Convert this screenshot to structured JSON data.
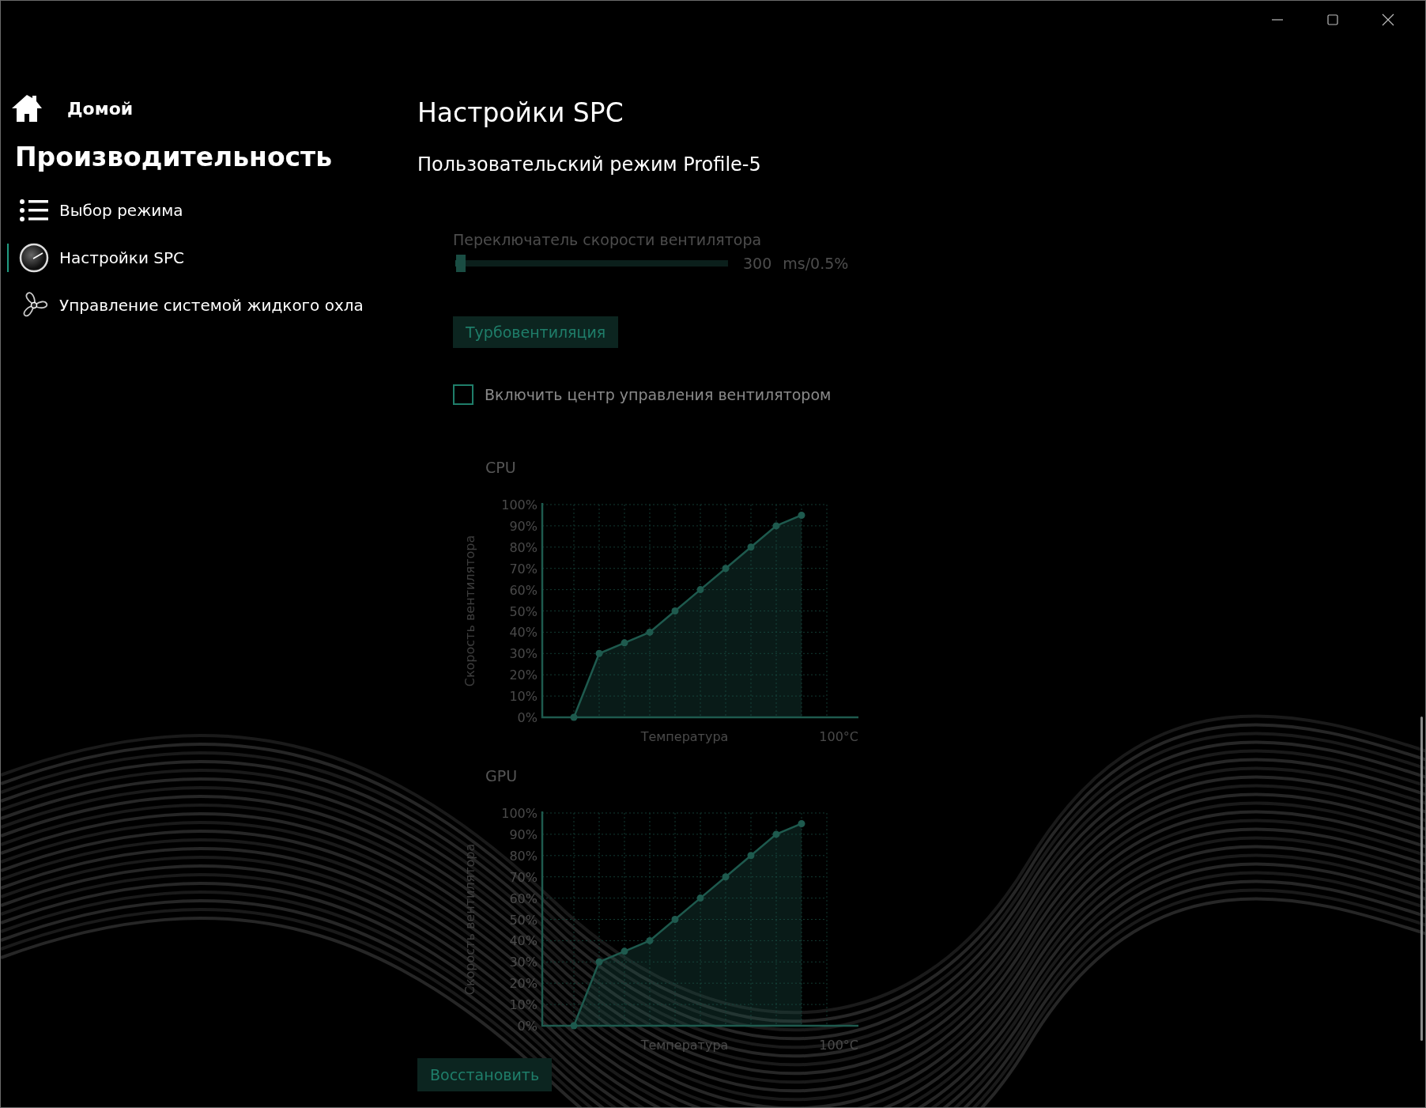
{
  "sidebar": {
    "home": "Домой",
    "section": "Производительность",
    "items": [
      {
        "kind": "list",
        "label": "Выбор режима",
        "selected": false
      },
      {
        "kind": "gauge",
        "label": "Настройки SPC",
        "selected": true
      },
      {
        "kind": "fan",
        "label": "Управление системой жидкого охла",
        "selected": false
      }
    ]
  },
  "page": {
    "title": "Настройки SPC",
    "subtitle": "Пользовательский режим Profile-5"
  },
  "fan_speed_switch": {
    "label": "Переключатель скорости вентилятора",
    "level": 0.02,
    "value": "300",
    "unit": "ms/0.5%"
  },
  "turbo_button": "Турбовентиляция",
  "fan_control": {
    "label": "Включить центр управления вентилятором",
    "checked": false
  },
  "charts": [
    {
      "label": "CPU",
      "chart_data": {
        "type": "area",
        "grid": true,
        "xlabel": "Температура",
        "ylabel": "Скорость вентилятора",
        "ylim": [
          0,
          100
        ],
        "annotations": [
          {
            "text": "100°C"
          }
        ],
        "yticks": [
          {
            "value": 0,
            "label": "0%"
          },
          {
            "value": 10,
            "label": "10%"
          },
          {
            "value": 20,
            "label": "20%"
          },
          {
            "value": 30,
            "label": "30%"
          },
          {
            "value": 40,
            "label": "40%"
          },
          {
            "value": 50,
            "label": "50%"
          },
          {
            "value": 60,
            "label": "60%"
          },
          {
            "value": 70,
            "label": "70%"
          },
          {
            "value": 80,
            "label": "80%"
          },
          {
            "value": 90,
            "label": "90%"
          },
          {
            "value": 100,
            "label": "100%"
          }
        ],
        "series": [
          {
            "color": "#1e5a4e",
            "values": [
              0,
              30,
              35,
              40,
              50,
              60,
              70,
              80,
              90,
              95
            ]
          }
        ]
      }
    },
    {
      "label": "GPU",
      "chart_data": {
        "type": "area",
        "grid": true,
        "xlabel": "Температура",
        "ylabel": "Скорость вентилятора",
        "ylim": [
          0,
          100
        ],
        "annotations": [
          {
            "text": "100°C"
          }
        ],
        "yticks": [
          {
            "value": 0,
            "label": "0%"
          },
          {
            "value": 10,
            "label": "10%"
          },
          {
            "value": 20,
            "label": "20%"
          },
          {
            "value": 30,
            "label": "30%"
          },
          {
            "value": 40,
            "label": "40%"
          },
          {
            "value": 50,
            "label": "50%"
          },
          {
            "value": 60,
            "label": "60%"
          },
          {
            "value": 70,
            "label": "70%"
          },
          {
            "value": 80,
            "label": "80%"
          },
          {
            "value": 90,
            "label": "90%"
          },
          {
            "value": 100,
            "label": "100%"
          }
        ],
        "series": [
          {
            "color": "#1e5a4e",
            "values": [
              0,
              30,
              35,
              40,
              50,
              60,
              70,
              80,
              90,
              95
            ]
          }
        ]
      }
    }
  ],
  "restore_button": "Восстановить"
}
